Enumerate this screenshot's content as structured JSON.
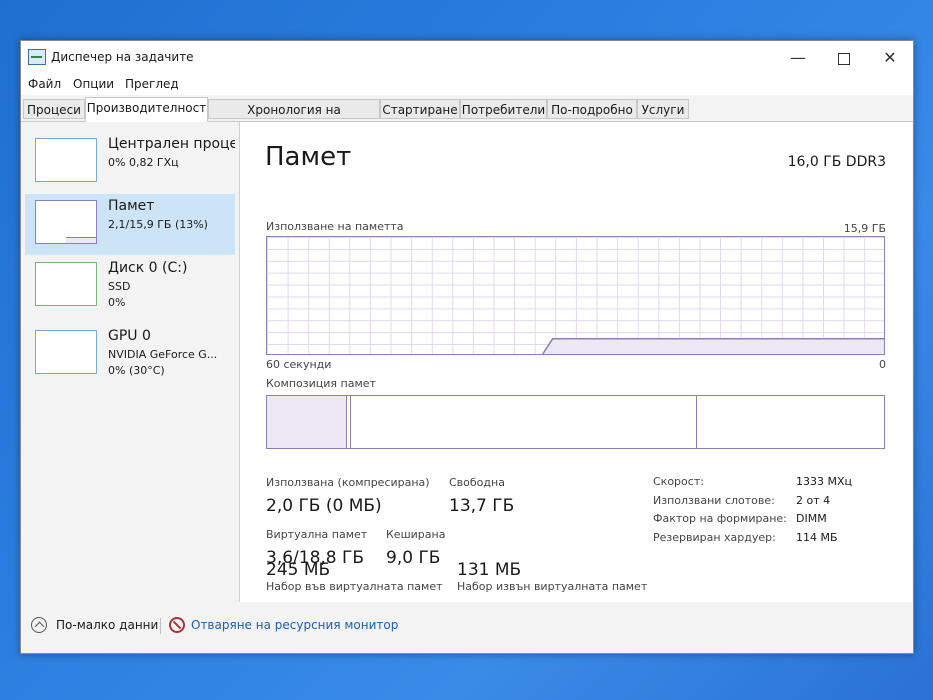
{
  "window": {
    "title": "Диспечер на задачите",
    "icon": "task-manager-icon"
  },
  "menu": [
    "Файл",
    "Опции",
    "Преглед"
  ],
  "tabs": [
    "Процеси",
    "Производителност",
    "Хронология на приложение",
    "Стартиране",
    "Потребители",
    "По-подробно",
    "Услуги"
  ],
  "active_tab": "Производителност",
  "sidebar": {
    "items": [
      {
        "name": "Централен проце",
        "line1": "0%  0,82 ГХц",
        "line2": ""
      },
      {
        "name": "Памет",
        "line1": "2,1/15,9 ГБ (13%)",
        "line2": ""
      },
      {
        "name": "Диск 0 (C:)",
        "line1": "SSD",
        "line2": "0%"
      },
      {
        "name": "GPU 0",
        "line1": "NVIDIA GeForce G...",
        "line2": "0%  (30°C)"
      }
    ]
  },
  "memory": {
    "title": "Памет",
    "total": "16,0 ГБ DDR3",
    "usage_label": "Използване на паметта",
    "usage_max": "15,9 ГБ",
    "time_left": "60 секунди",
    "time_right": "0",
    "composition_label": "Композиция памет",
    "usage_fraction": 0.13,
    "stats": {
      "in_use_label": "Използвана (компресирана)",
      "in_use_value": "2,0 ГБ (0 МБ)",
      "available_label": "Свободна",
      "available_value": "13,7 ГБ",
      "committed_label": "Виртуална памет",
      "committed_value": "3,6/18,8 ГБ",
      "cached_label": "Кеширана",
      "cached_value": "9,0 ГБ",
      "paged_pool_label": "Набор във виртуалната памет",
      "paged_pool_value": "245 МБ",
      "nonpaged_pool_label": "Набор извън виртуалната памет",
      "nonpaged_pool_value": "131 МБ"
    },
    "details": [
      {
        "label": "Скорост:",
        "value": "1333 MХц"
      },
      {
        "label": "Използвани слотове:",
        "value": "2 от 4"
      },
      {
        "label": "Фактор на формиране:",
        "value": "DIMM"
      },
      {
        "label": "Резервиран хардуер:",
        "value": "114 МБ"
      }
    ]
  },
  "footer": {
    "fewer_details": "По-малко данни",
    "resource_monitor": "Отваряне на ресурсния монитор"
  },
  "colors": {
    "memory_accent": "#8d7fb8",
    "selected_bg": "#cde4f7"
  }
}
